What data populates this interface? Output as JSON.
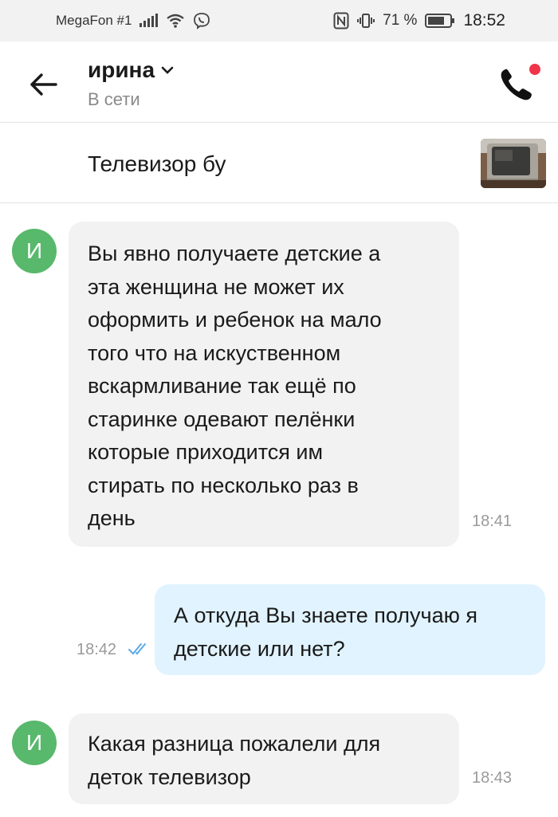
{
  "status_bar": {
    "carrier": "MegaFon #1",
    "battery": "71 %",
    "time": "18:52",
    "icons": [
      "signal-icon",
      "wifi-icon",
      "viber-icon",
      "nfc-icon",
      "vibrate-icon",
      "battery-icon"
    ]
  },
  "header": {
    "contact_name": "ирина",
    "contact_status": "В сети",
    "call_notification_color": "#f0354a"
  },
  "listing": {
    "title": "Телевизор бу"
  },
  "messages": [
    {
      "direction": "incoming",
      "avatar_letter": "И",
      "lines": [
        "Вы явно получаете детские а",
        "эта женщина не может их",
        "оформить и ребенок на мало",
        "того что на искуственном",
        "вскармливание так ещё по",
        "старинке одевают пелёнки",
        "которые приходится им",
        "стирать по несколько раз в",
        "день"
      ],
      "time": "18:41"
    },
    {
      "direction": "outgoing",
      "lines": [
        "А откуда Вы знаете получаю я",
        "детские или нет?"
      ],
      "time": "18:42",
      "read": true
    },
    {
      "direction": "incoming",
      "avatar_letter": "И",
      "lines": [
        "Какая разница пожалели для",
        "деток телевизор"
      ],
      "time": "18:43"
    }
  ],
  "colors": {
    "incoming_bubble": "#f2f2f2",
    "outgoing_bubble": "#e1f3fe",
    "avatar": "#58b86b",
    "read_check": "#5aa9e6"
  }
}
